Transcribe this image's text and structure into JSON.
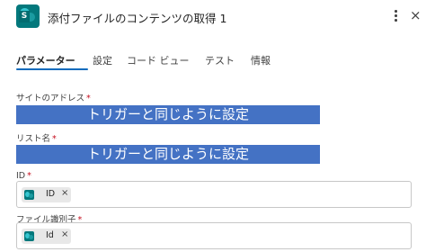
{
  "header": {
    "title": "添付ファイルのコンテンツの取得 1",
    "app_icon": "sharepoint-icon",
    "more_icon": "more-vertical-icon",
    "close_glyph": "×"
  },
  "tabs": [
    {
      "label": "パラメーター",
      "active": true
    },
    {
      "label": "設定",
      "active": false
    },
    {
      "label": "コード ビュー",
      "active": false
    },
    {
      "label": "テスト",
      "active": false
    },
    {
      "label": "情報",
      "active": false
    }
  ],
  "fields": {
    "site_address": {
      "label": "サイトのアドレス",
      "required": "*",
      "overlay_text": "トリガーと同じように設定"
    },
    "list_name": {
      "label": "リスト名",
      "required": "*",
      "overlay_text": "トリガーと同じように設定"
    },
    "id": {
      "label": "ID",
      "required": "*",
      "token_label": "ID",
      "token_remove": "×"
    },
    "file_identifier": {
      "label": "ファイル識別子",
      "required": "*",
      "token_label": "Id",
      "token_remove": "×"
    }
  },
  "colors": {
    "accent": "#0f6cbd",
    "overlay": "#4472c4",
    "required": "#c50f1f",
    "sharepoint": "#03787c"
  }
}
